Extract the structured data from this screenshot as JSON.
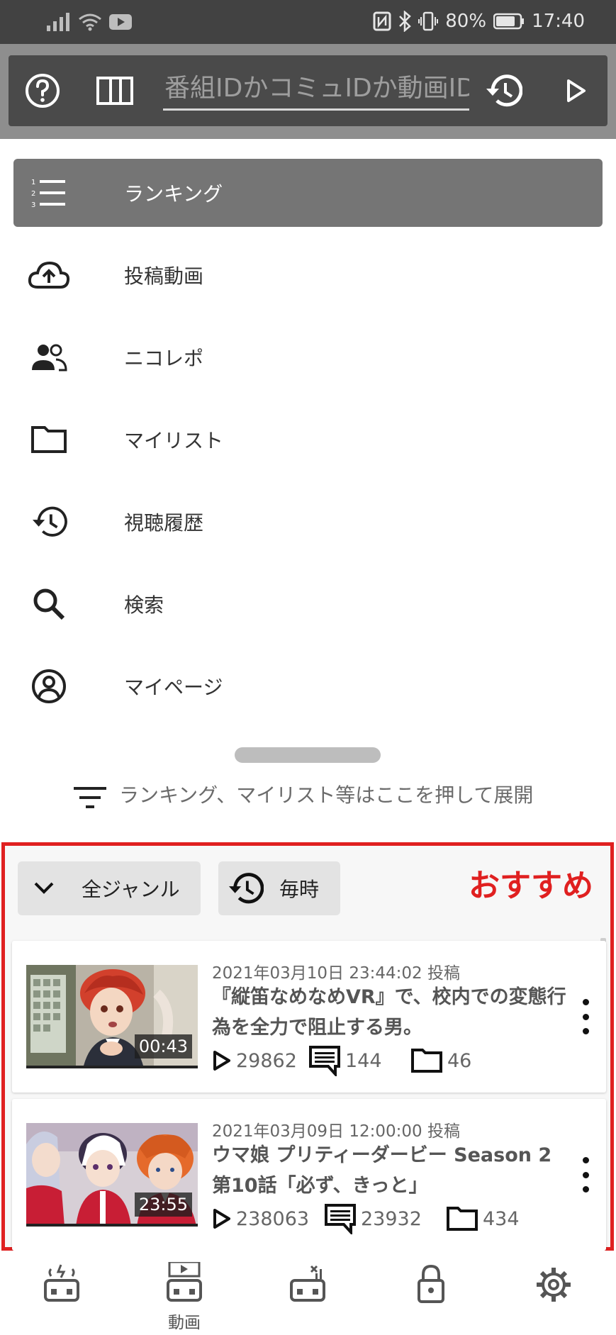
{
  "status_bar": {
    "battery_percent": "80%",
    "time": "17:40",
    "icons_left": [
      "signal-icon",
      "wifi-icon",
      "youtube-notification-icon"
    ],
    "icons_right": [
      "nfc-icon",
      "bluetooth-icon",
      "vibrate-icon",
      "battery-icon"
    ]
  },
  "toolbar": {
    "help_icon": "help-circle-icon",
    "columns_icon": "columns-icon",
    "search_placeholder": "番組IDかコミュIDか動画ID",
    "history_icon": "history-icon",
    "play_icon": "play-icon"
  },
  "menu": {
    "items": [
      {
        "label": "ランキング",
        "icon": "ranking-list-icon",
        "active": true
      },
      {
        "label": "投稿動画",
        "icon": "cloud-upload-icon",
        "active": false
      },
      {
        "label": "ニコレポ",
        "icon": "people-icon",
        "active": false
      },
      {
        "label": "マイリスト",
        "icon": "folder-icon",
        "active": false
      },
      {
        "label": "視聴履歴",
        "icon": "history-icon",
        "active": false
      },
      {
        "label": "検索",
        "icon": "search-icon",
        "active": false
      },
      {
        "label": "マイページ",
        "icon": "account-circle-icon",
        "active": false
      }
    ]
  },
  "expand_hint": "ランキング、マイリスト等はここを押して展開",
  "recommended": {
    "title": "おすすめ",
    "accent_color": "#e02020",
    "genre_chip": "全ジャンル",
    "time_chip": "毎時",
    "videos": [
      {
        "date": "2021年03月10日 23:44:02 投稿",
        "title": "『縦笛なめなめVR』で、校内での変態行為を全力で阻止する男。",
        "duration": "00:43",
        "views": "29862",
        "comments": "144",
        "mylists": "46"
      },
      {
        "date": "2021年03月09日 12:00:00 投稿",
        "title": "ウマ娘 プリティーダービー Season 2 第10話「必ず、きっと」",
        "duration": "23:55",
        "views": "238063",
        "comments": "23932",
        "mylists": "434"
      }
    ]
  },
  "bottom_nav": {
    "items": [
      {
        "icon": "live-broadcast-icon",
        "label": ""
      },
      {
        "icon": "video-icon",
        "label": "動画"
      },
      {
        "icon": "game-icon",
        "label": ""
      },
      {
        "icon": "lock-icon",
        "label": ""
      },
      {
        "icon": "settings-gear-icon",
        "label": ""
      }
    ]
  }
}
